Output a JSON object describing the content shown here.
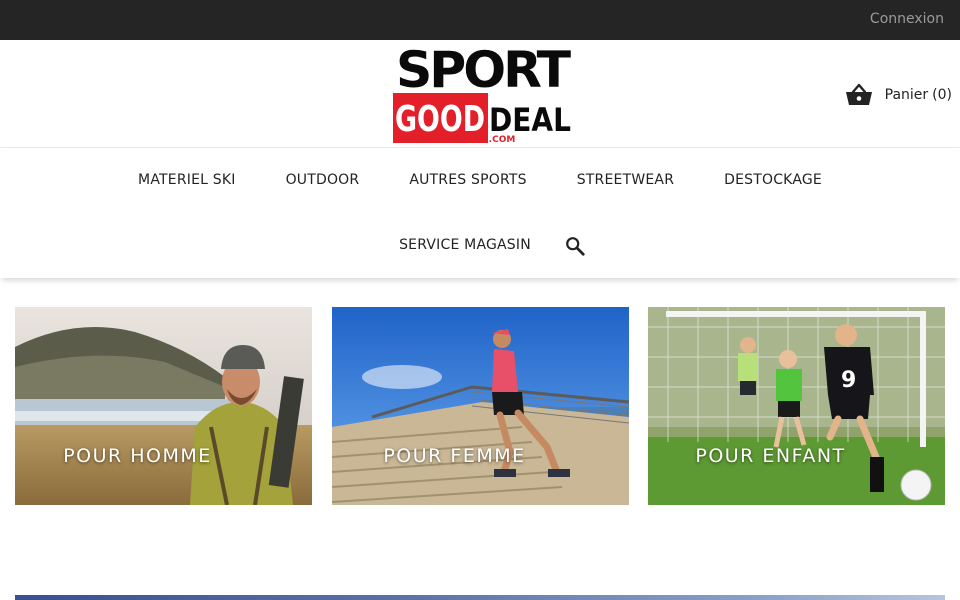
{
  "topbar": {
    "login_label": "Connexion"
  },
  "header": {
    "logo": {
      "line1": "SPORT",
      "line2a": "GOOD",
      "line2b": "DEAL",
      "line3": ".COM"
    },
    "cart": {
      "icon": "basket-icon",
      "label": "Panier",
      "count": "(0)"
    }
  },
  "nav": {
    "row1": [
      "MATERIEL SKI",
      "OUTDOOR",
      "AUTRES SPORTS",
      "STREETWEAR",
      "DESTOCKAGE"
    ],
    "row2": [
      "SERVICE MAGASIN"
    ],
    "search_icon": "search-icon"
  },
  "banners": [
    {
      "label": "POUR HOMME"
    },
    {
      "label": "POUR FEMME"
    },
    {
      "label": "POUR ENFANT"
    }
  ],
  "colors": {
    "topbar_bg": "#252525",
    "logo_red": "#e3202a",
    "text": "#232323"
  }
}
